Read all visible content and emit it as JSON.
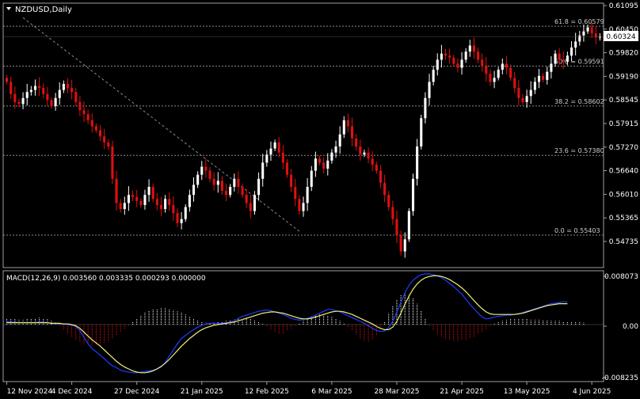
{
  "symbol_label": "NZDUSD,Daily",
  "current_price_label": "0.60324",
  "colors": {
    "background": "#000000",
    "axis": "#a0a0a0",
    "text": "#ffffff",
    "bull_candle": "#ffffff",
    "bear_candle": "#e01010",
    "fib_line": "#8a8a8a",
    "trendline": "#8a8a8a",
    "macd_line": "#1e3cff",
    "signal_line": "#f2ef7a",
    "hist_pos": "#ffffff",
    "hist_neg": "#e01010",
    "price_tag_bg": "#ffffff",
    "price_tag_text": "#000000"
  },
  "chart_data": [
    {
      "type": "candlestick",
      "title": "NZDUSD,Daily",
      "ylim": [
        0.546,
        0.6115
      ],
      "y_ticks": [
        "0.61095",
        "0.60450",
        "0.59820",
        "0.59190",
        "0.58545",
        "0.57915",
        "0.57270",
        "0.56640",
        "0.56010",
        "0.55365",
        "0.54735"
      ],
      "x_ticks": [
        "12 Nov 2024",
        "4 Dec 2024",
        "27 Dec 2024",
        "21 Jan 2025",
        "12 Feb 2025",
        "6 Mar 2025",
        "28 Mar 2025",
        "21 Apr 2025",
        "13 May 2025",
        "4 Jun 2025"
      ],
      "x_tick_bar_index": [
        0,
        16,
        32,
        48,
        64,
        80,
        96,
        112,
        128,
        144
      ],
      "fib_levels": [
        {
          "label": "61.8 = 0.60579",
          "value": 0.60579
        },
        {
          "label": "50.0 = 0.59591",
          "value": 0.59591
        },
        {
          "label": "38.2 = 0.58602",
          "value": 0.58602
        },
        {
          "label": "23.6 = 0.57380",
          "value": 0.5738
        },
        {
          "label": "0.0 = 0.55403",
          "value": 0.55403
        }
      ],
      "trendline": [
        {
          "bar": 4,
          "price": 0.6079
        },
        {
          "bar": 72,
          "price": 0.555
        }
      ],
      "last_price": 0.60324,
      "closes": [
        0.592,
        0.589,
        0.587,
        0.5865,
        0.588,
        0.5895,
        0.59,
        0.591,
        0.5905,
        0.589,
        0.5875,
        0.586,
        0.588,
        0.59,
        0.5915,
        0.5905,
        0.5895,
        0.587,
        0.585,
        0.584,
        0.5825,
        0.581,
        0.58,
        0.5785,
        0.577,
        0.576,
        0.568,
        0.562,
        0.5605,
        0.562,
        0.564,
        0.5635,
        0.5625,
        0.5615,
        0.564,
        0.566,
        0.563,
        0.5615,
        0.5605,
        0.563,
        0.5615,
        0.5595,
        0.557,
        0.558,
        0.561,
        0.564,
        0.5665,
        0.569,
        0.571,
        0.57,
        0.568,
        0.5665,
        0.5675,
        0.565,
        0.564,
        0.566,
        0.568,
        0.566,
        0.564,
        0.562,
        0.56,
        0.564,
        0.568,
        0.572,
        0.574,
        0.5755,
        0.577,
        0.5745,
        0.572,
        0.569,
        0.566,
        0.563,
        0.56,
        0.562,
        0.566,
        0.57,
        0.573,
        0.572,
        0.5705,
        0.5725,
        0.5745,
        0.576,
        0.579,
        0.5825,
        0.581,
        0.578,
        0.576,
        0.574,
        0.5745,
        0.573,
        0.5715,
        0.57,
        0.567,
        0.564,
        0.561,
        0.558,
        0.554,
        0.55,
        0.553,
        0.56,
        0.568,
        0.576,
        0.583,
        0.588,
        0.592,
        0.595,
        0.5975,
        0.599,
        0.5985,
        0.598,
        0.5965,
        0.5955,
        0.5975,
        0.5995,
        0.601,
        0.5995,
        0.5975,
        0.596,
        0.594,
        0.592,
        0.593,
        0.595,
        0.5965,
        0.5955,
        0.593,
        0.5905,
        0.588,
        0.587,
        0.5885,
        0.59,
        0.592,
        0.5935,
        0.5925,
        0.5945,
        0.5965,
        0.599,
        0.5975,
        0.597,
        0.5985,
        0.6005,
        0.602,
        0.6035,
        0.6045,
        0.6055,
        0.604,
        0.603,
        0.6032
      ]
    },
    {
      "type": "line",
      "title": "MACD(12,26,9) 0.003560 0.003335 0.000293 0.000000",
      "ylim": [
        -0.009,
        0.0085
      ],
      "y_ticks": [
        "0.008073",
        "0.00",
        "-0.008235"
      ],
      "series": [
        {
          "name": "MACD main",
          "kind": "line",
          "values": [
            0.0005,
            0.0004,
            0.0004,
            0.0003,
            0.0003,
            0.0003,
            0.0003,
            0.0003,
            0.0004,
            0.0004,
            0.0003,
            0.0002,
            0.0001,
            0.0001,
            0.0001,
            0.0,
            -0.0001,
            -0.0003,
            -0.001,
            -0.002,
            -0.003,
            -0.0038,
            -0.0043,
            -0.0048,
            -0.0054,
            -0.006,
            -0.0065,
            -0.0068,
            -0.0072,
            -0.0074,
            -0.0075,
            -0.0076,
            -0.0076,
            -0.0075,
            -0.0074,
            -0.0073,
            -0.0072,
            -0.007,
            -0.0067,
            -0.006,
            -0.005,
            -0.004,
            -0.003,
            -0.0022,
            -0.0017,
            -0.0012,
            -0.0008,
            -0.0004,
            -0.0001,
            0.0001,
            0.0002,
            0.0002,
            0.0002,
            0.0002,
            0.0003,
            0.0004,
            0.0006,
            0.001,
            0.0013,
            0.0015,
            0.0017,
            0.0019,
            0.0021,
            0.0022,
            0.0023,
            0.0022,
            0.002,
            0.0018,
            0.0016,
            0.0013,
            0.001,
            0.0008,
            0.0007,
            0.0008,
            0.001,
            0.0012,
            0.0015,
            0.0018,
            0.0021,
            0.0024,
            0.0024,
            0.0022,
            0.002,
            0.0017,
            0.0014,
            0.0011,
            0.0008,
            0.0005,
            0.0002,
            -0.0002,
            -0.0006,
            -0.0009,
            -0.0011,
            -0.001,
            -0.0005,
            0.0005,
            0.002,
            0.0035,
            0.005,
            0.0062,
            0.007,
            0.0075,
            0.0079,
            0.008,
            0.008,
            0.0079,
            0.0077,
            0.0074,
            0.007,
            0.0065,
            0.006,
            0.0054,
            0.0048,
            0.004,
            0.0032,
            0.0025,
            0.0018,
            0.0012,
            0.0009,
            0.001,
            0.0012,
            0.0013,
            0.0014,
            0.0015,
            0.0015,
            0.0016,
            0.0017,
            0.0019,
            0.0021,
            0.0023,
            0.0025,
            0.0027,
            0.0029,
            0.0031,
            0.0033,
            0.0034,
            0.0035,
            0.0036,
            0.0036
          ]
        },
        {
          "name": "Signal",
          "kind": "line",
          "values": [
            0.0003,
            0.0003,
            0.0003,
            0.0003,
            0.0003,
            0.0003,
            0.0003,
            0.0003,
            0.0003,
            0.0003,
            0.0003,
            0.0002,
            0.0002,
            0.0002,
            0.0001,
            0.0001,
            0.0,
            -0.0002,
            -0.0006,
            -0.0012,
            -0.0018,
            -0.0024,
            -0.0029,
            -0.0034,
            -0.004,
            -0.0046,
            -0.0052,
            -0.0058,
            -0.0063,
            -0.0067,
            -0.007,
            -0.0073,
            -0.0075,
            -0.0076,
            -0.0076,
            -0.0075,
            -0.0073,
            -0.007,
            -0.0066,
            -0.0061,
            -0.0055,
            -0.0048,
            -0.0041,
            -0.0034,
            -0.0028,
            -0.0022,
            -0.0017,
            -0.0012,
            -0.0008,
            -0.0005,
            -0.0003,
            -0.0001,
            0.0,
            0.0001,
            0.0002,
            0.0003,
            0.0004,
            0.0006,
            0.0008,
            0.001,
            0.0012,
            0.0014,
            0.0016,
            0.0018,
            0.0019,
            0.002,
            0.002,
            0.0019,
            0.0018,
            0.0016,
            0.0014,
            0.0012,
            0.001,
            0.0009,
            0.0009,
            0.001,
            0.0012,
            0.0014,
            0.0016,
            0.0018,
            0.002,
            0.0021,
            0.0021,
            0.002,
            0.0018,
            0.0016,
            0.0013,
            0.001,
            0.0007,
            0.0004,
            0.0001,
            -0.0003,
            -0.0006,
            -0.0008,
            -0.0008,
            -0.0004,
            0.0005,
            0.0018,
            0.0032,
            0.0045,
            0.0056,
            0.0064,
            0.007,
            0.0074,
            0.0076,
            0.0077,
            0.0077,
            0.0076,
            0.0074,
            0.0071,
            0.0067,
            0.0063,
            0.0058,
            0.0052,
            0.0045,
            0.0038,
            0.0031,
            0.0025,
            0.002,
            0.0017,
            0.0016,
            0.0016,
            0.0016,
            0.0016,
            0.0016,
            0.0016,
            0.0017,
            0.0018,
            0.002,
            0.0022,
            0.0024,
            0.0026,
            0.0028,
            0.003,
            0.0031,
            0.0032,
            0.0033,
            0.0033,
            0.0033
          ]
        },
        {
          "name": "Histogram",
          "kind": "bars",
          "values": [
            0.001,
            0.0009,
            0.0009,
            0.0008,
            0.0008,
            0.0009,
            0.001,
            0.001,
            0.0011,
            0.001,
            0.0009,
            0.0006,
            0.0003,
            -0.0002,
            -0.0008,
            -0.0014,
            -0.0019,
            -0.0024,
            -0.0028,
            -0.0031,
            -0.0033,
            -0.0034,
            -0.0033,
            -0.0031,
            -0.0029,
            -0.0026,
            -0.0022,
            -0.0017,
            -0.0012,
            -0.0007,
            -0.0002,
            0.0004,
            0.001,
            0.0015,
            0.0019,
            0.0022,
            0.0024,
            0.0025,
            0.0026,
            0.0026,
            0.0025,
            0.0023,
            0.0021,
            0.0019,
            0.0016,
            0.0013,
            0.001,
            0.0007,
            0.0005,
            0.0003,
            0.0002,
            0.0003,
            0.0004,
            0.0005,
            0.0006,
            0.0007,
            0.0008,
            0.0009,
            0.001,
            0.001,
            0.0009,
            0.0007,
            0.0004,
            0.0001,
            -0.0003,
            -0.0008,
            -0.0012,
            -0.0015,
            -0.0014,
            -0.001,
            -0.0006,
            -0.0002,
            0.0002,
            0.0006,
            0.001,
            0.0013,
            0.0015,
            0.0016,
            0.0016,
            0.0015,
            0.0013,
            0.001,
            0.0006,
            0.0002,
            -0.0004,
            -0.001,
            -0.0016,
            -0.0022,
            -0.0026,
            -0.0028,
            -0.0025,
            -0.0018,
            -0.0008,
            0.0005,
            0.0018,
            0.003,
            0.004,
            0.0047,
            0.005,
            0.0048,
            0.0042,
            0.0033,
            0.0022,
            0.001,
            -0.0002,
            -0.001,
            -0.0016,
            -0.002,
            -0.0023,
            -0.0025,
            -0.0026,
            -0.0026,
            -0.0025,
            -0.0024,
            -0.0022,
            -0.0019,
            -0.0015,
            -0.0011,
            -0.0007,
            -0.0003,
            0.0001,
            0.0004,
            0.0006,
            0.0008,
            0.0009,
            0.001,
            0.001,
            0.001,
            0.0009,
            0.0008,
            0.0008,
            0.0008,
            0.0007,
            0.0007,
            0.0006,
            0.0006,
            0.0006,
            0.0005,
            0.0005,
            0.0005,
            0.0004,
            0.0004,
            0.0003
          ]
        }
      ]
    }
  ]
}
